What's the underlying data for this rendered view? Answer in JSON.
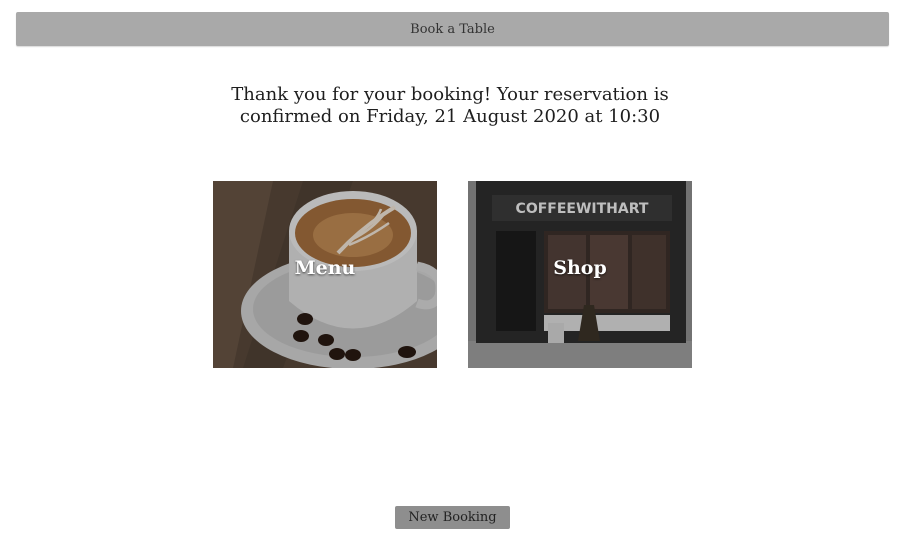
{
  "header": {
    "title": "Book a Table"
  },
  "confirmation": {
    "line1": "Thank you for your booking! Your reservation is",
    "line2": "confirmed on Friday, 21 August 2020 at 10:30"
  },
  "tiles": [
    {
      "label": "Menu",
      "image": "coffee-cup-latte-art"
    },
    {
      "label": "Shop",
      "image": "coffee-shop-storefront",
      "sign_text": "COFFEEWITHART"
    }
  ],
  "footer": {
    "new_booking_label": "New Booking"
  }
}
